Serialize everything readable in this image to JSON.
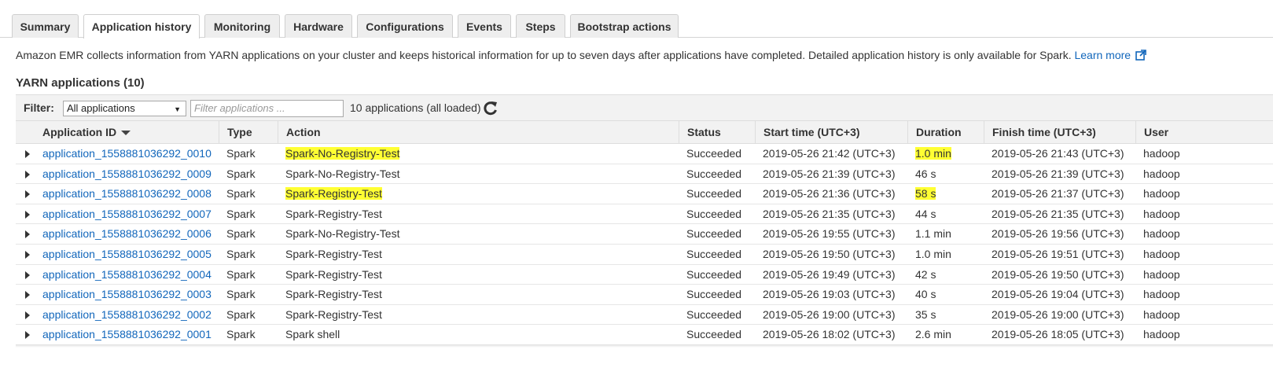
{
  "tabs": [
    {
      "label": "Summary",
      "active": false
    },
    {
      "label": "Application history",
      "active": true
    },
    {
      "label": "Monitoring",
      "active": false
    },
    {
      "label": "Hardware",
      "active": false
    },
    {
      "label": "Configurations",
      "active": false
    },
    {
      "label": "Events",
      "active": false
    },
    {
      "label": "Steps",
      "active": false
    },
    {
      "label": "Bootstrap actions",
      "active": false
    }
  ],
  "info": {
    "text": "Amazon EMR collects information from YARN applications on your cluster and keeps historical information for up to seven days after applications have completed. Detailed application history is only available for Spark.",
    "link_label": "Learn more",
    "link_icon": "external-link-icon"
  },
  "section_title": "YARN applications (10)",
  "filter": {
    "label": "Filter:",
    "selected": "All applications",
    "placeholder": "Filter applications ...",
    "count_text": "10 applications (all loaded)",
    "refresh_icon": "refresh-icon"
  },
  "table": {
    "columns": [
      "Application ID",
      "Type",
      "Action",
      "Status",
      "Start time (UTC+3)",
      "Duration",
      "Finish time (UTC+3)",
      "User"
    ],
    "rows": [
      {
        "id": "application_1558881036292_0010",
        "type": "Spark",
        "action": "Spark-No-Registry-Test",
        "status": "Succeeded",
        "start": "2019-05-26 21:42 (UTC+3)",
        "duration": "1.0 min",
        "finish": "2019-05-26 21:43 (UTC+3)",
        "user": "hadoop",
        "highlight_action": true,
        "highlight_duration": true
      },
      {
        "id": "application_1558881036292_0009",
        "type": "Spark",
        "action": "Spark-No-Registry-Test",
        "status": "Succeeded",
        "start": "2019-05-26 21:39 (UTC+3)",
        "duration": "46 s",
        "finish": "2019-05-26 21:39 (UTC+3)",
        "user": "hadoop",
        "highlight_action": false,
        "highlight_duration": false
      },
      {
        "id": "application_1558881036292_0008",
        "type": "Spark",
        "action": "Spark-Registry-Test",
        "status": "Succeeded",
        "start": "2019-05-26 21:36 (UTC+3)",
        "duration": "58 s",
        "finish": "2019-05-26 21:37 (UTC+3)",
        "user": "hadoop",
        "highlight_action": true,
        "highlight_duration": true
      },
      {
        "id": "application_1558881036292_0007",
        "type": "Spark",
        "action": "Spark-Registry-Test",
        "status": "Succeeded",
        "start": "2019-05-26 21:35 (UTC+3)",
        "duration": "44 s",
        "finish": "2019-05-26 21:35 (UTC+3)",
        "user": "hadoop",
        "highlight_action": false,
        "highlight_duration": false
      },
      {
        "id": "application_1558881036292_0006",
        "type": "Spark",
        "action": "Spark-No-Registry-Test",
        "status": "Succeeded",
        "start": "2019-05-26 19:55 (UTC+3)",
        "duration": "1.1 min",
        "finish": "2019-05-26 19:56 (UTC+3)",
        "user": "hadoop",
        "highlight_action": false,
        "highlight_duration": false
      },
      {
        "id": "application_1558881036292_0005",
        "type": "Spark",
        "action": "Spark-Registry-Test",
        "status": "Succeeded",
        "start": "2019-05-26 19:50 (UTC+3)",
        "duration": "1.0 min",
        "finish": "2019-05-26 19:51 (UTC+3)",
        "user": "hadoop",
        "highlight_action": false,
        "highlight_duration": false
      },
      {
        "id": "application_1558881036292_0004",
        "type": "Spark",
        "action": "Spark-Registry-Test",
        "status": "Succeeded",
        "start": "2019-05-26 19:49 (UTC+3)",
        "duration": "42 s",
        "finish": "2019-05-26 19:50 (UTC+3)",
        "user": "hadoop",
        "highlight_action": false,
        "highlight_duration": false
      },
      {
        "id": "application_1558881036292_0003",
        "type": "Spark",
        "action": "Spark-Registry-Test",
        "status": "Succeeded",
        "start": "2019-05-26 19:03 (UTC+3)",
        "duration": "40 s",
        "finish": "2019-05-26 19:04 (UTC+3)",
        "user": "hadoop",
        "highlight_action": false,
        "highlight_duration": false
      },
      {
        "id": "application_1558881036292_0002",
        "type": "Spark",
        "action": "Spark-Registry-Test",
        "status": "Succeeded",
        "start": "2019-05-26 19:00 (UTC+3)",
        "duration": "35 s",
        "finish": "2019-05-26 19:00 (UTC+3)",
        "user": "hadoop",
        "highlight_action": false,
        "highlight_duration": false
      },
      {
        "id": "application_1558881036292_0001",
        "type": "Spark",
        "action": "Spark shell",
        "status": "Succeeded",
        "start": "2019-05-26 18:02 (UTC+3)",
        "duration": "2.6 min",
        "finish": "2019-05-26 18:05 (UTC+3)",
        "user": "hadoop",
        "highlight_action": false,
        "highlight_duration": false
      }
    ]
  },
  "colors": {
    "link": "#1166bb",
    "highlight": "#ffff33",
    "header_bg": "#f2f2f2"
  }
}
